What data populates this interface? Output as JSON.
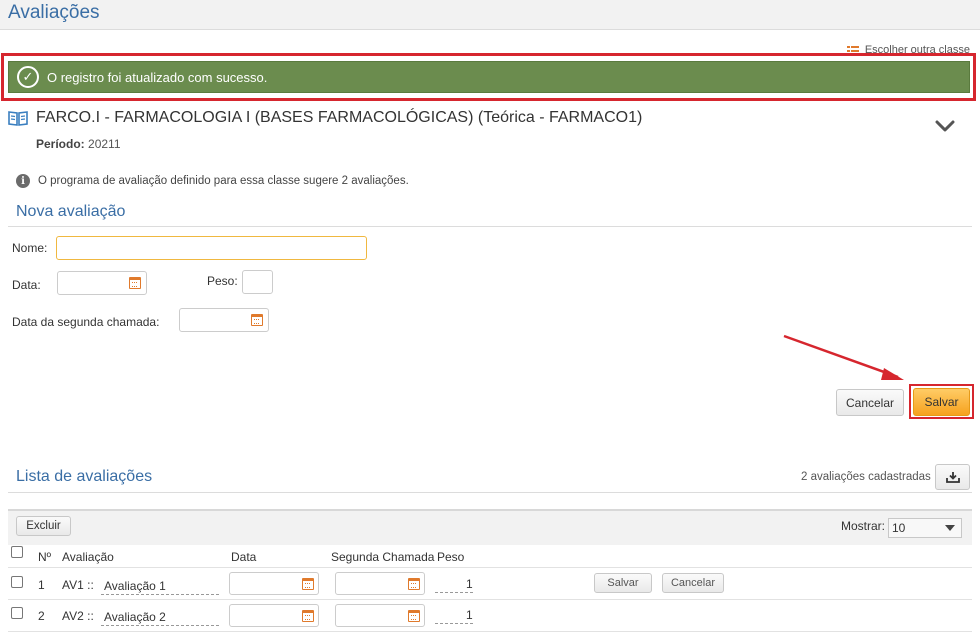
{
  "page": {
    "title": "Avaliações"
  },
  "header": {
    "choose_class": "Escolher outra classe"
  },
  "alert": {
    "message": "O registro foi atualizado com sucesso."
  },
  "classe": {
    "title": "FARCO.I - FARMACOLOGIA I (BASES FARMACOLÓGICAS) (Teórica - FARMACO1)",
    "periodo_label": "Período:",
    "periodo_value": "20211"
  },
  "info": "O programa de avaliação definido para essa classe sugere 2 avaliações.",
  "nova": {
    "title": "Nova avaliação",
    "nome_label": "Nome:",
    "nome_value": "",
    "data_label": "Data:",
    "data_value": "",
    "peso_label": "Peso:",
    "peso_value": "",
    "segunda_label": "Data da segunda chamada:",
    "segunda_value": "",
    "cancel": "Cancelar",
    "save": "Salvar"
  },
  "lista": {
    "title": "Lista de avaliações",
    "count": "2 avaliações cadastradas",
    "delete": "Excluir",
    "show_label": "Mostrar:",
    "show_value": "10",
    "columns": {
      "no": "Nº",
      "avaliacao": "Avaliação",
      "data": "Data",
      "segunda": "Segunda Chamada",
      "peso": "Peso"
    },
    "rows": [
      {
        "no": "1",
        "code": "AV1 ::",
        "name": "Avaliação 1",
        "data": "",
        "segunda": "",
        "peso": "1",
        "save": "Salvar",
        "cancel": "Cancelar"
      },
      {
        "no": "2",
        "code": "AV2 ::",
        "name": "Avaliação 2",
        "data": "",
        "segunda": "",
        "peso": "1"
      }
    ]
  },
  "colors": {
    "accent": "#3a6ea5",
    "success": "#6b8c4e",
    "highlight": "#d6262e",
    "primary_button": "#f6a21e",
    "icon_orange": "#e07a2c"
  },
  "icons": {
    "alert": "check-circle-icon",
    "class": "book-icon",
    "choose": "list-icon",
    "expand": "chevron-down-icon",
    "info": "info-icon",
    "download": "download-icon",
    "date": "calendar-icon"
  }
}
